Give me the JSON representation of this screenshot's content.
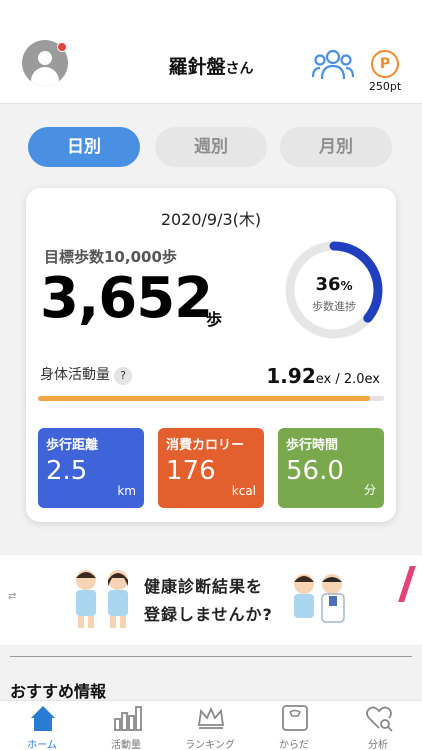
{
  "header": {
    "title": "羅針盤",
    "title_suffix": "さん",
    "points_symbol": "P",
    "points": "250pt",
    "avatar_badge_color": "#e8403a"
  },
  "tabs": [
    {
      "label": "日別",
      "active": true
    },
    {
      "label": "週別",
      "active": false
    },
    {
      "label": "月別",
      "active": false
    }
  ],
  "summary": {
    "date": "2020/9/3(木)",
    "goal": "目標歩数10,000歩",
    "steps": "3,652",
    "steps_unit": "歩",
    "progress_percent": 36,
    "progress_symbol": "%",
    "progress_label": "歩数進捗",
    "activity_label": "身体活動量",
    "help": "?",
    "activity_value": "1.92",
    "activity_unit": "ex / 2.0ex",
    "activity_fraction": 0.96
  },
  "tiles": [
    {
      "label": "歩行距離",
      "value": "2.5",
      "unit": "km",
      "color": "#3f63d8"
    },
    {
      "label": "消費カロリー",
      "value": "176",
      "unit": "kcal",
      "color": "#e45f2e"
    },
    {
      "label": "歩行時間",
      "value": "56.0",
      "unit": "分",
      "color": "#7aa84c"
    }
  ],
  "banner": {
    "line1": "健康診断結果を",
    "line2": "登録しませんか?"
  },
  "section_title": "おすすめ情報",
  "nav": [
    {
      "label": "ホーム",
      "icon": "home-icon",
      "active": true
    },
    {
      "label": "活動量",
      "icon": "bar-chart-icon",
      "active": false
    },
    {
      "label": "ランキング",
      "icon": "crown-icon",
      "active": false
    },
    {
      "label": "からだ",
      "icon": "scale-icon",
      "active": false
    },
    {
      "label": "分析",
      "icon": "heart-search-icon",
      "active": false
    }
  ],
  "colors": {
    "accent": "#4a90e2",
    "ring": "#1f3fbf",
    "points": "#ef8a2f",
    "activity_bar": "#f0a444"
  }
}
